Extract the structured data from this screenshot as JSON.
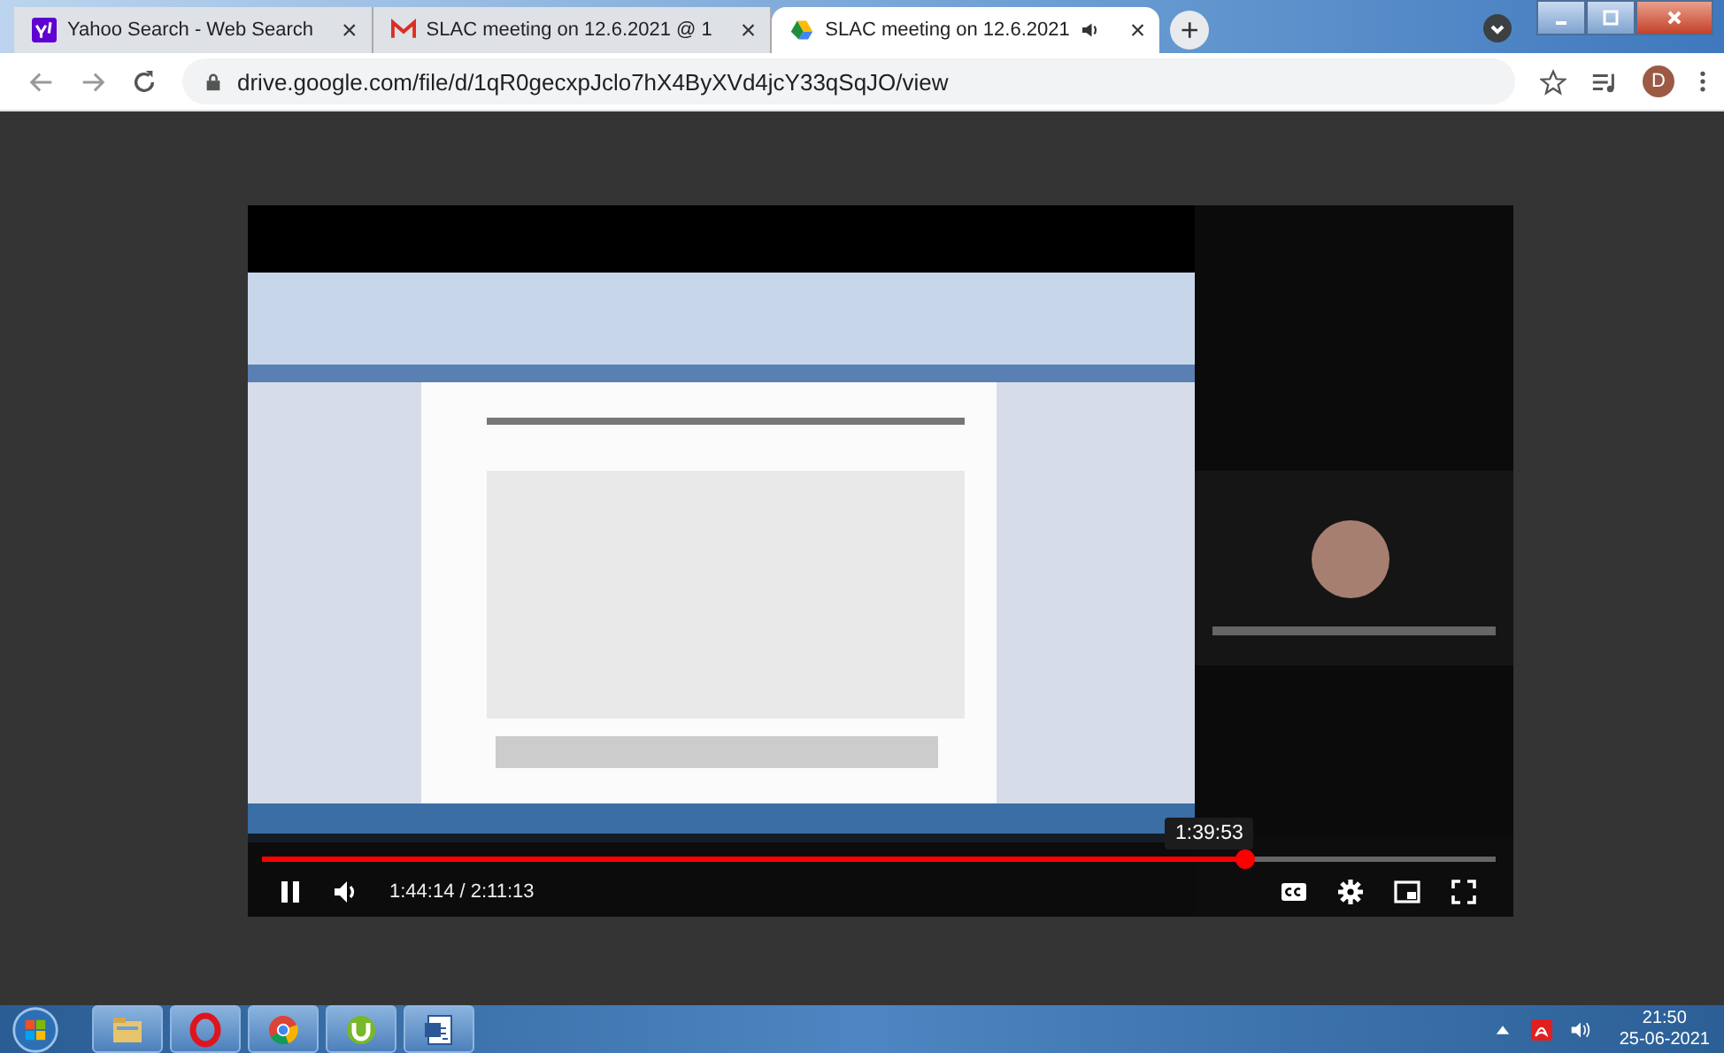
{
  "browser": {
    "tabs": [
      {
        "title": "Yahoo Search - Web Search",
        "kind": "yahoo",
        "selected": false,
        "audio": false,
        "close": "×"
      },
      {
        "title": "SLAC meeting on 12.6.2021 @ 1",
        "kind": "gmail",
        "selected": false,
        "audio": false,
        "close": "×"
      },
      {
        "title": "SLAC meeting on 12.6.2021",
        "kind": "drive",
        "selected": true,
        "audio": true,
        "close": "×"
      }
    ],
    "new_tab": "+",
    "address": "drive.google.com/file/d/1qR0gecxpJclo7hX4ByXVd4jcY33qSqJO/view",
    "profile": "D"
  },
  "player": {
    "tooltip": "1:39:53",
    "progress": {
      "level": 0.796
    },
    "time": "1:44:14 / 2:11:13",
    "playing": true
  },
  "taskbar": {
    "clock": {
      "time": "21:50",
      "date": "25-06-2021"
    }
  }
}
